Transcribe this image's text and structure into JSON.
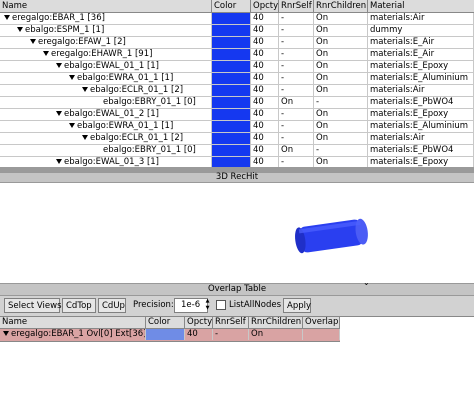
{
  "tree": {
    "headers": [
      "Name",
      "Color",
      "Opcty",
      "RnrSelf",
      "RnrChildren",
      "Material"
    ],
    "rows": [
      {
        "name": "eregalgo:EBAR_1 [36]",
        "indent": 0,
        "opcty": "40",
        "rnrself": "-",
        "rnrchildren": "On",
        "material": "materials:Air"
      },
      {
        "name": "ebalgo:ESPM_1 [1]",
        "indent": 1,
        "opcty": "40",
        "rnrself": "-",
        "rnrchildren": "On",
        "material": "dummy"
      },
      {
        "name": "eregalgo:EFAW_1 [2]",
        "indent": 2,
        "opcty": "40",
        "rnrself": "-",
        "rnrchildren": "On",
        "material": "materials:E_Air"
      },
      {
        "name": "eregalgo:EHAWR_1 [91]",
        "indent": 3,
        "opcty": "40",
        "rnrself": "-",
        "rnrchildren": "On",
        "material": "materials:E_Air"
      },
      {
        "name": "ebalgo:EWAL_01_1 [1]",
        "indent": 4,
        "opcty": "40",
        "rnrself": "-",
        "rnrchildren": "On",
        "material": "materials:E_Epoxy"
      },
      {
        "name": "ebalgo:EWRA_01_1 [1]",
        "indent": 5,
        "opcty": "40",
        "rnrself": "-",
        "rnrchildren": "On",
        "material": "materials:E_Aluminium"
      },
      {
        "name": "ebalgo:ECLR_01_1 [2]",
        "indent": 6,
        "opcty": "40",
        "rnrself": "-",
        "rnrchildren": "On",
        "material": "materials:Air"
      },
      {
        "name": "ebalgo:EBRY_01_1 [0]",
        "indent": 7,
        "opcty": "40",
        "rnrself": "On",
        "rnrchildren": "-",
        "material": "materials:E_PbWO4"
      },
      {
        "name": "ebalgo:EWAL_01_2 [1]",
        "indent": 4,
        "opcty": "40",
        "rnrself": "-",
        "rnrchildren": "On",
        "material": "materials:E_Epoxy"
      },
      {
        "name": "ebalgo:EWRA_01_1 [1]",
        "indent": 5,
        "opcty": "40",
        "rnrself": "-",
        "rnrchildren": "On",
        "material": "materials:E_Aluminium"
      },
      {
        "name": "ebalgo:ECLR_01_1 [2]",
        "indent": 6,
        "opcty": "40",
        "rnrself": "-",
        "rnrchildren": "On",
        "material": "materials:Air"
      },
      {
        "name": "ebalgo:EBRY_01_1 [0]",
        "indent": 7,
        "opcty": "40",
        "rnrself": "On",
        "rnrchildren": "-",
        "material": "materials:E_PbWO4"
      },
      {
        "name": "ebalgo:EWAL_01_3 [1]",
        "indent": 4,
        "opcty": "40",
        "rnrself": "-",
        "rnrchildren": "On",
        "material": "materials:E_Epoxy"
      }
    ]
  },
  "view3d": {
    "title": "3D RecHit"
  },
  "overlap_table": {
    "title": "Overlap Table"
  },
  "toolbar": {
    "select_views": "Select Views",
    "cdtop": "CdTop",
    "cdup": "CdUp",
    "precision_label": "Precision:",
    "precision_value": "1e-6",
    "list_all_nodes": "ListAllNodes",
    "apply": "Apply"
  },
  "overlap": {
    "headers": [
      "Name",
      "Color",
      "Opcty",
      "RnrSelf",
      "RnrChildren",
      "Overlap"
    ],
    "row": {
      "name": "eregalgo:EBAR_1 Ovl[0] Ext[36]",
      "opcty": "40",
      "rnrself": "-",
      "rnrchildren": "On",
      "overlap": ""
    }
  },
  "colors": {
    "object_blue": "#1538f0",
    "overlap_row": "#d9a3a3",
    "overlap_color": "#6f8ce6"
  }
}
